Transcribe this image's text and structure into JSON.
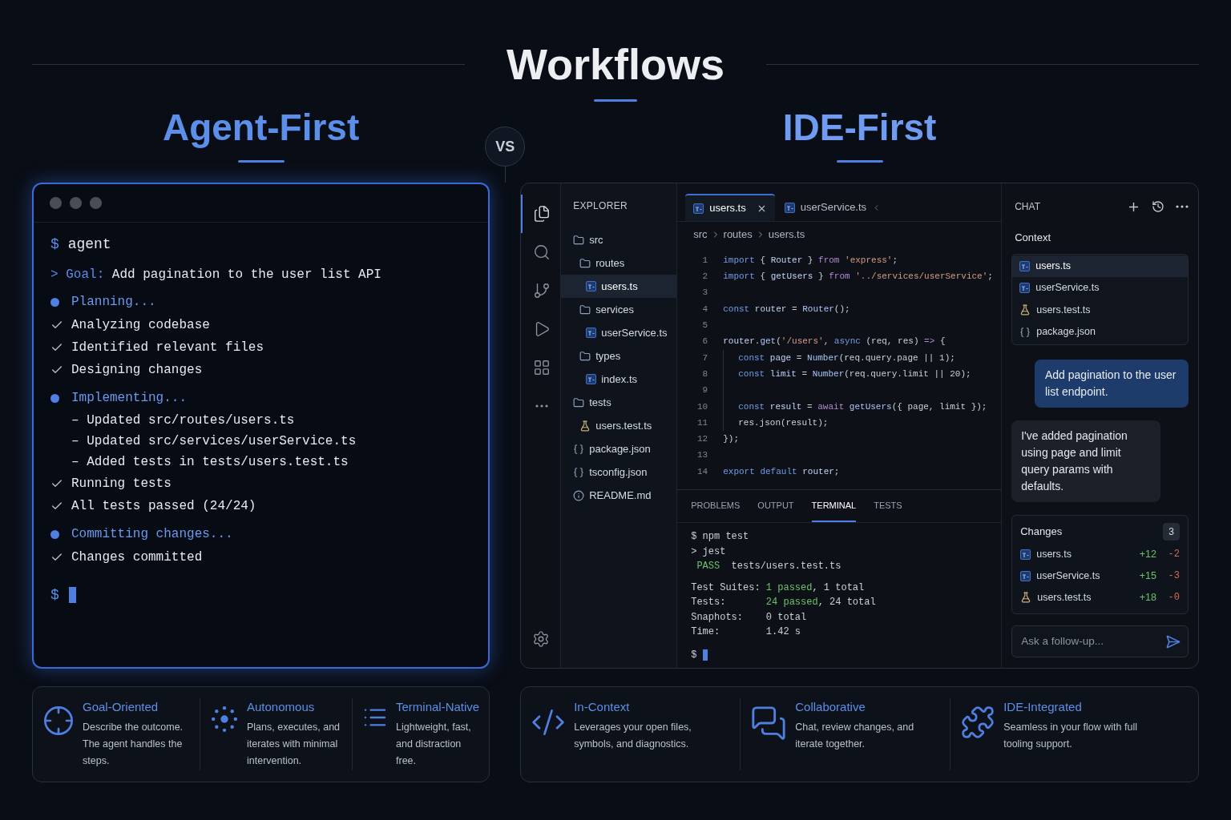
{
  "title": "Workflows",
  "vs": "VS",
  "agent_first": {
    "heading": "Agent-First",
    "terminal": {
      "lines": [
        {
          "kind": "command",
          "prefix": "$",
          "text": "agent"
        },
        {
          "kind": "goal",
          "prefix": ">",
          "label": "Goal:",
          "text": "Add pagination to the user list API"
        },
        {
          "kind": "phase",
          "text": "Planning..."
        },
        {
          "kind": "done",
          "text": "Analyzing codebase"
        },
        {
          "kind": "done",
          "text": "Identified relevant files"
        },
        {
          "kind": "done",
          "text": "Designing changes"
        },
        {
          "kind": "phase",
          "text": "Implementing..."
        },
        {
          "kind": "sub",
          "prefix": "–",
          "text": "Updated src/routes/users.ts"
        },
        {
          "kind": "sub",
          "prefix": "–",
          "text": "Updated src/services/userService.ts"
        },
        {
          "kind": "sub",
          "prefix": "–",
          "text": "Added tests in tests/users.test.ts"
        },
        {
          "kind": "done",
          "text": "Running tests"
        },
        {
          "kind": "done",
          "text": "All tests passed (24/24)"
        },
        {
          "kind": "phase",
          "text": "Committing changes..."
        },
        {
          "kind": "done",
          "text": "Changes committed"
        },
        {
          "kind": "prompt",
          "prefix": "$"
        }
      ]
    },
    "features": [
      {
        "title": "Goal-Oriented",
        "description": "Describe the outcome. The agent handles the steps."
      },
      {
        "title": "Autonomous",
        "description": "Plans, executes, and iterates with minimal intervention."
      },
      {
        "title": "Terminal-Native",
        "description": "Lightweight, fast, and distraction free."
      }
    ]
  },
  "ide_first": {
    "heading": "IDE-First",
    "activity_bar": [
      {
        "selected": true
      },
      {
        "selected": false
      },
      {
        "selected": false
      },
      {
        "selected": false
      },
      {
        "selected": false
      },
      {
        "selected": false
      }
    ],
    "explorer": {
      "title": "EXPLORER",
      "tree": [
        {
          "label": "src",
          "kind": "folder",
          "selected": false,
          "children": [
            {
              "label": "routes",
              "kind": "folder",
              "selected": false,
              "children": [
                {
                  "label": "users.ts",
                  "kind": "ts",
                  "selected": true
                }
              ]
            },
            {
              "label": "services",
              "kind": "folder",
              "selected": false,
              "children": [
                {
                  "label": "userService.ts",
                  "kind": "ts",
                  "selected": false
                }
              ]
            },
            {
              "label": "types",
              "kind": "folder",
              "selected": false,
              "children": [
                {
                  "label": "index.ts",
                  "kind": "ts",
                  "selected": false
                }
              ]
            }
          ]
        },
        {
          "label": "tests",
          "kind": "folder",
          "selected": false,
          "children": [
            {
              "label": "users.test.ts",
              "kind": "test",
              "selected": false
            }
          ]
        },
        {
          "label": "package.json",
          "kind": "json",
          "selected": false
        },
        {
          "label": "tsconfig.json",
          "kind": "json",
          "selected": false
        },
        {
          "label": "README.md",
          "kind": "info",
          "selected": false
        }
      ]
    },
    "tabs": [
      {
        "label": "users.ts",
        "selected": true
      },
      {
        "label": "userService.ts",
        "selected": false
      }
    ],
    "breadcrumb": [
      "src",
      "routes",
      "users.ts"
    ],
    "code": [
      {
        "number": "1",
        "tokens": [
          {
            "kind": "kw",
            "text": "import "
          },
          {
            "kind": "p",
            "text": "{ "
          },
          {
            "kind": "id",
            "text": "Router"
          },
          {
            "kind": "p",
            "text": " } "
          },
          {
            "kind": "kw2",
            "text": "from "
          },
          {
            "kind": "str",
            "text": "'express'"
          },
          {
            "kind": "p",
            "text": ";"
          }
        ]
      },
      {
        "number": "2",
        "tokens": [
          {
            "kind": "kw",
            "text": "import "
          },
          {
            "kind": "p",
            "text": "{ "
          },
          {
            "kind": "id",
            "text": "getUsers"
          },
          {
            "kind": "p",
            "text": " } "
          },
          {
            "kind": "kw2",
            "text": "from "
          },
          {
            "kind": "str",
            "text": "'../services/userService'"
          },
          {
            "kind": "p",
            "text": ";"
          }
        ]
      },
      {
        "number": "3"
      },
      {
        "number": "4",
        "tokens": [
          {
            "kind": "kw",
            "text": "const "
          },
          {
            "kind": "id",
            "text": "router"
          },
          {
            "kind": "p",
            "text": " = "
          },
          {
            "kind": "fn",
            "text": "Router"
          },
          {
            "kind": "p",
            "text": "();"
          }
        ]
      },
      {
        "number": "5"
      },
      {
        "number": "6",
        "tokens": [
          {
            "kind": "id",
            "text": "router"
          },
          {
            "kind": "p",
            "text": "."
          },
          {
            "kind": "fn",
            "text": "get"
          },
          {
            "kind": "p",
            "text": "("
          },
          {
            "kind": "str",
            "text": "'/users'"
          },
          {
            "kind": "p",
            "text": ", "
          },
          {
            "kind": "kw",
            "text": "async "
          },
          {
            "kind": "p",
            "text": "(req, res) "
          },
          {
            "kind": "kw2",
            "text": "=> "
          },
          {
            "kind": "p",
            "text": "{"
          }
        ]
      },
      {
        "number": "7",
        "in_block": true,
        "tokens": [
          {
            "kind": "kw",
            "text": "const "
          },
          {
            "kind": "id",
            "text": "page"
          },
          {
            "kind": "p",
            "text": " = "
          },
          {
            "kind": "fn",
            "text": "Number"
          },
          {
            "kind": "p",
            "text": "(req.query.page || 1);"
          }
        ]
      },
      {
        "number": "8",
        "in_block": true,
        "tokens": [
          {
            "kind": "kw",
            "text": "const "
          },
          {
            "kind": "id",
            "text": "limit"
          },
          {
            "kind": "p",
            "text": " = "
          },
          {
            "kind": "fn",
            "text": "Number"
          },
          {
            "kind": "p",
            "text": "(req.query.limit || 20);"
          }
        ]
      },
      {
        "number": "9",
        "in_block": true
      },
      {
        "number": "10",
        "in_block": true,
        "tokens": [
          {
            "kind": "kw",
            "text": "const "
          },
          {
            "kind": "id",
            "text": "result"
          },
          {
            "kind": "p",
            "text": " = "
          },
          {
            "kind": "kw2",
            "text": "await "
          },
          {
            "kind": "fn",
            "text": "getUsers"
          },
          {
            "kind": "p",
            "text": "({ page, limit });"
          }
        ]
      },
      {
        "number": "11",
        "in_block": true,
        "tokens": [
          {
            "kind": "p",
            "text": "res.json(result);"
          }
        ]
      },
      {
        "number": "12",
        "tokens": [
          {
            "kind": "p",
            "text": "});"
          }
        ]
      },
      {
        "number": "13"
      },
      {
        "number": "14",
        "tokens": [
          {
            "kind": "kw",
            "text": "export default "
          },
          {
            "kind": "id",
            "text": "router"
          },
          {
            "kind": "p",
            "text": ";"
          }
        ]
      }
    ],
    "panel": {
      "tabs": [
        {
          "label": "PROBLEMS",
          "selected": false
        },
        {
          "label": "OUTPUT",
          "selected": false
        },
        {
          "label": "TERMINAL",
          "selected": true
        },
        {
          "label": "TESTS",
          "selected": false
        }
      ],
      "output": [
        [
          {
            "kind": "p",
            "text": "$ npm test"
          }
        ],
        [
          {
            "kind": "p",
            "text": "> jest"
          }
        ],
        [
          {
            "kind": "pass",
            "text": " PASS"
          },
          {
            "kind": "p",
            "text": "  tests/users.test.ts"
          }
        ]
      ],
      "summary": [
        [
          {
            "kind": "p",
            "text": "Test Suites: "
          },
          {
            "kind": "pass",
            "text": "1 passed"
          },
          {
            "kind": "p",
            "text": ", 1 total"
          }
        ],
        [
          {
            "kind": "p",
            "text": "Tests:       "
          },
          {
            "kind": "pass",
            "text": "24 passed"
          },
          {
            "kind": "p",
            "text": ", 24 total"
          }
        ],
        [
          {
            "kind": "p",
            "text": "Snaphots:    0 total"
          }
        ],
        [
          {
            "kind": "p",
            "text": "Time:        1.42 s"
          }
        ]
      ],
      "prompt": "$"
    },
    "chat": {
      "title": "CHAT",
      "context_label": "Context",
      "context": [
        {
          "label": "users.ts",
          "kind": "ts",
          "selected": true
        },
        {
          "label": "userService.ts",
          "kind": "ts",
          "selected": false
        },
        {
          "label": "users.test.ts",
          "kind": "test",
          "selected": false
        },
        {
          "label": "package.json",
          "kind": "json",
          "selected": false
        }
      ],
      "messages": [
        {
          "kind": "user",
          "text": "Add pagination to the user list endpoint."
        },
        {
          "kind": "assistant",
          "text": "I've added pagination using page and limit query params with defaults."
        }
      ],
      "changes": {
        "title": "Changes",
        "count": "3",
        "files": [
          {
            "name": "users.ts",
            "kind": "ts",
            "added": "+12",
            "removed": "-2"
          },
          {
            "name": "userService.ts",
            "kind": "ts",
            "added": "+15",
            "removed": "-3"
          },
          {
            "name": "users.test.ts",
            "kind": "test",
            "added": "+18",
            "removed": "-0"
          }
        ]
      },
      "input": {
        "placeholder": "Ask a follow-up..."
      }
    },
    "features": [
      {
        "title": "In-Context",
        "description": "Leverages your open files, symbols, and diagnostics."
      },
      {
        "title": "Collaborative",
        "description": "Chat, review changes, and iterate together."
      },
      {
        "title": "IDE-Integrated",
        "description": "Seamless in your flow with full tooling support."
      }
    ]
  }
}
